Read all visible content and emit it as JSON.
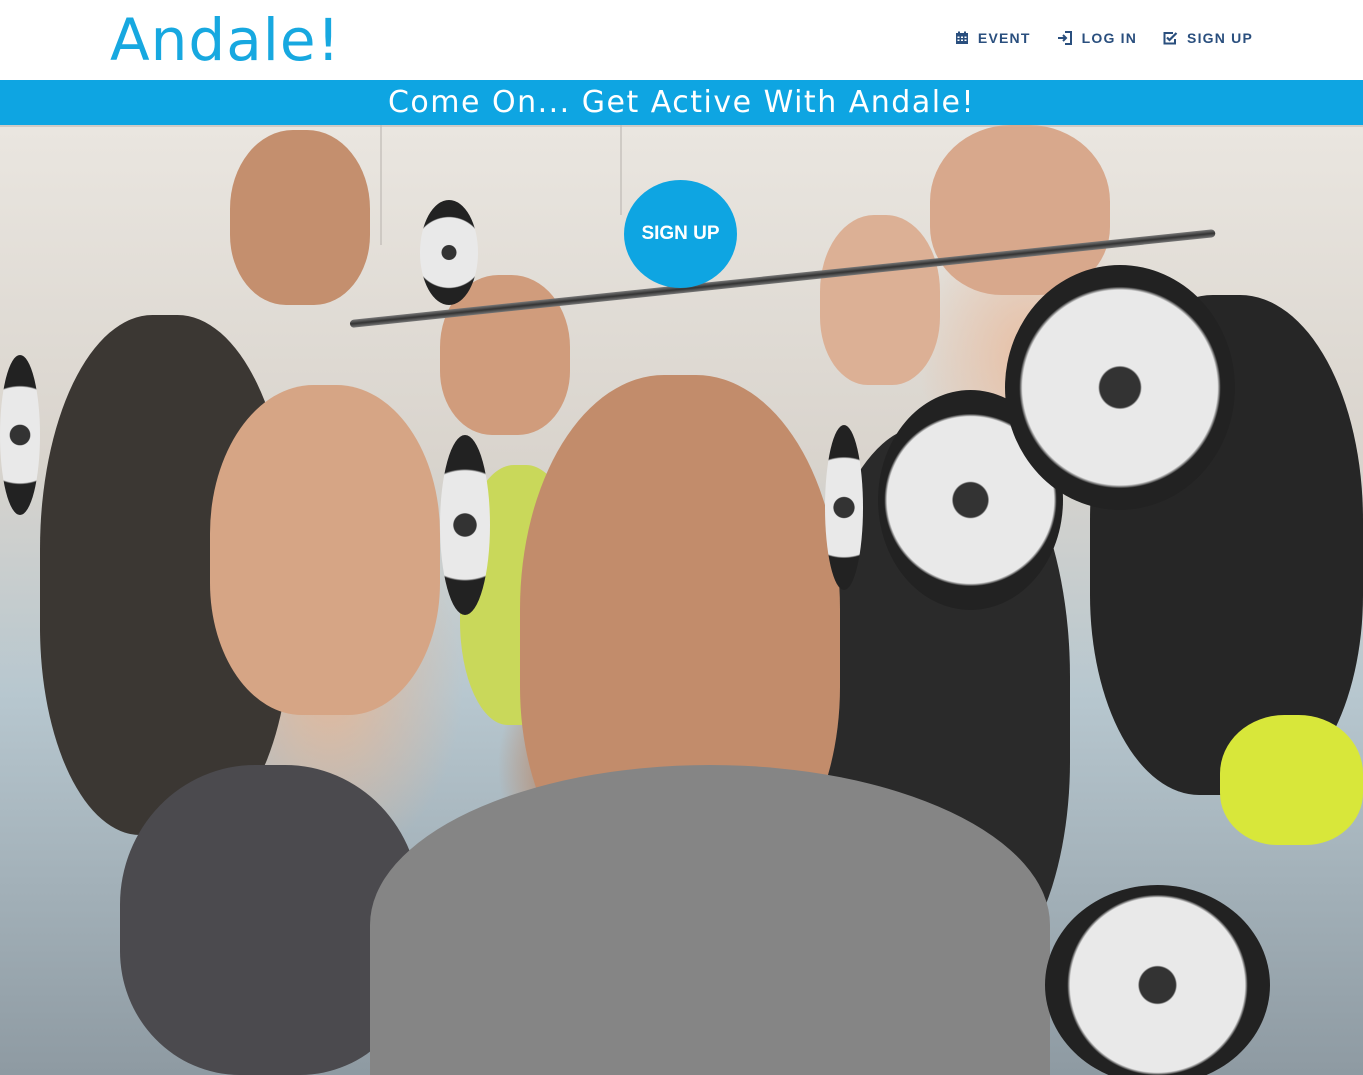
{
  "logo": {
    "text": "Andale!"
  },
  "nav": {
    "items": [
      {
        "label": "EVENT",
        "icon": "calendar-icon"
      },
      {
        "label": "LOG IN",
        "icon": "login-icon"
      },
      {
        "label": "SIGN UP",
        "icon": "checkbox-edit-icon"
      }
    ]
  },
  "banner": {
    "tagline": "Come On... Get Active With Andale!"
  },
  "hero": {
    "image": "gym-group-selfie",
    "cta_label": "SIGN UP"
  },
  "colors": {
    "brand_blue": "#0ea5e2",
    "nav_text": "#2a4f7e",
    "logo": "#17a8e0"
  }
}
